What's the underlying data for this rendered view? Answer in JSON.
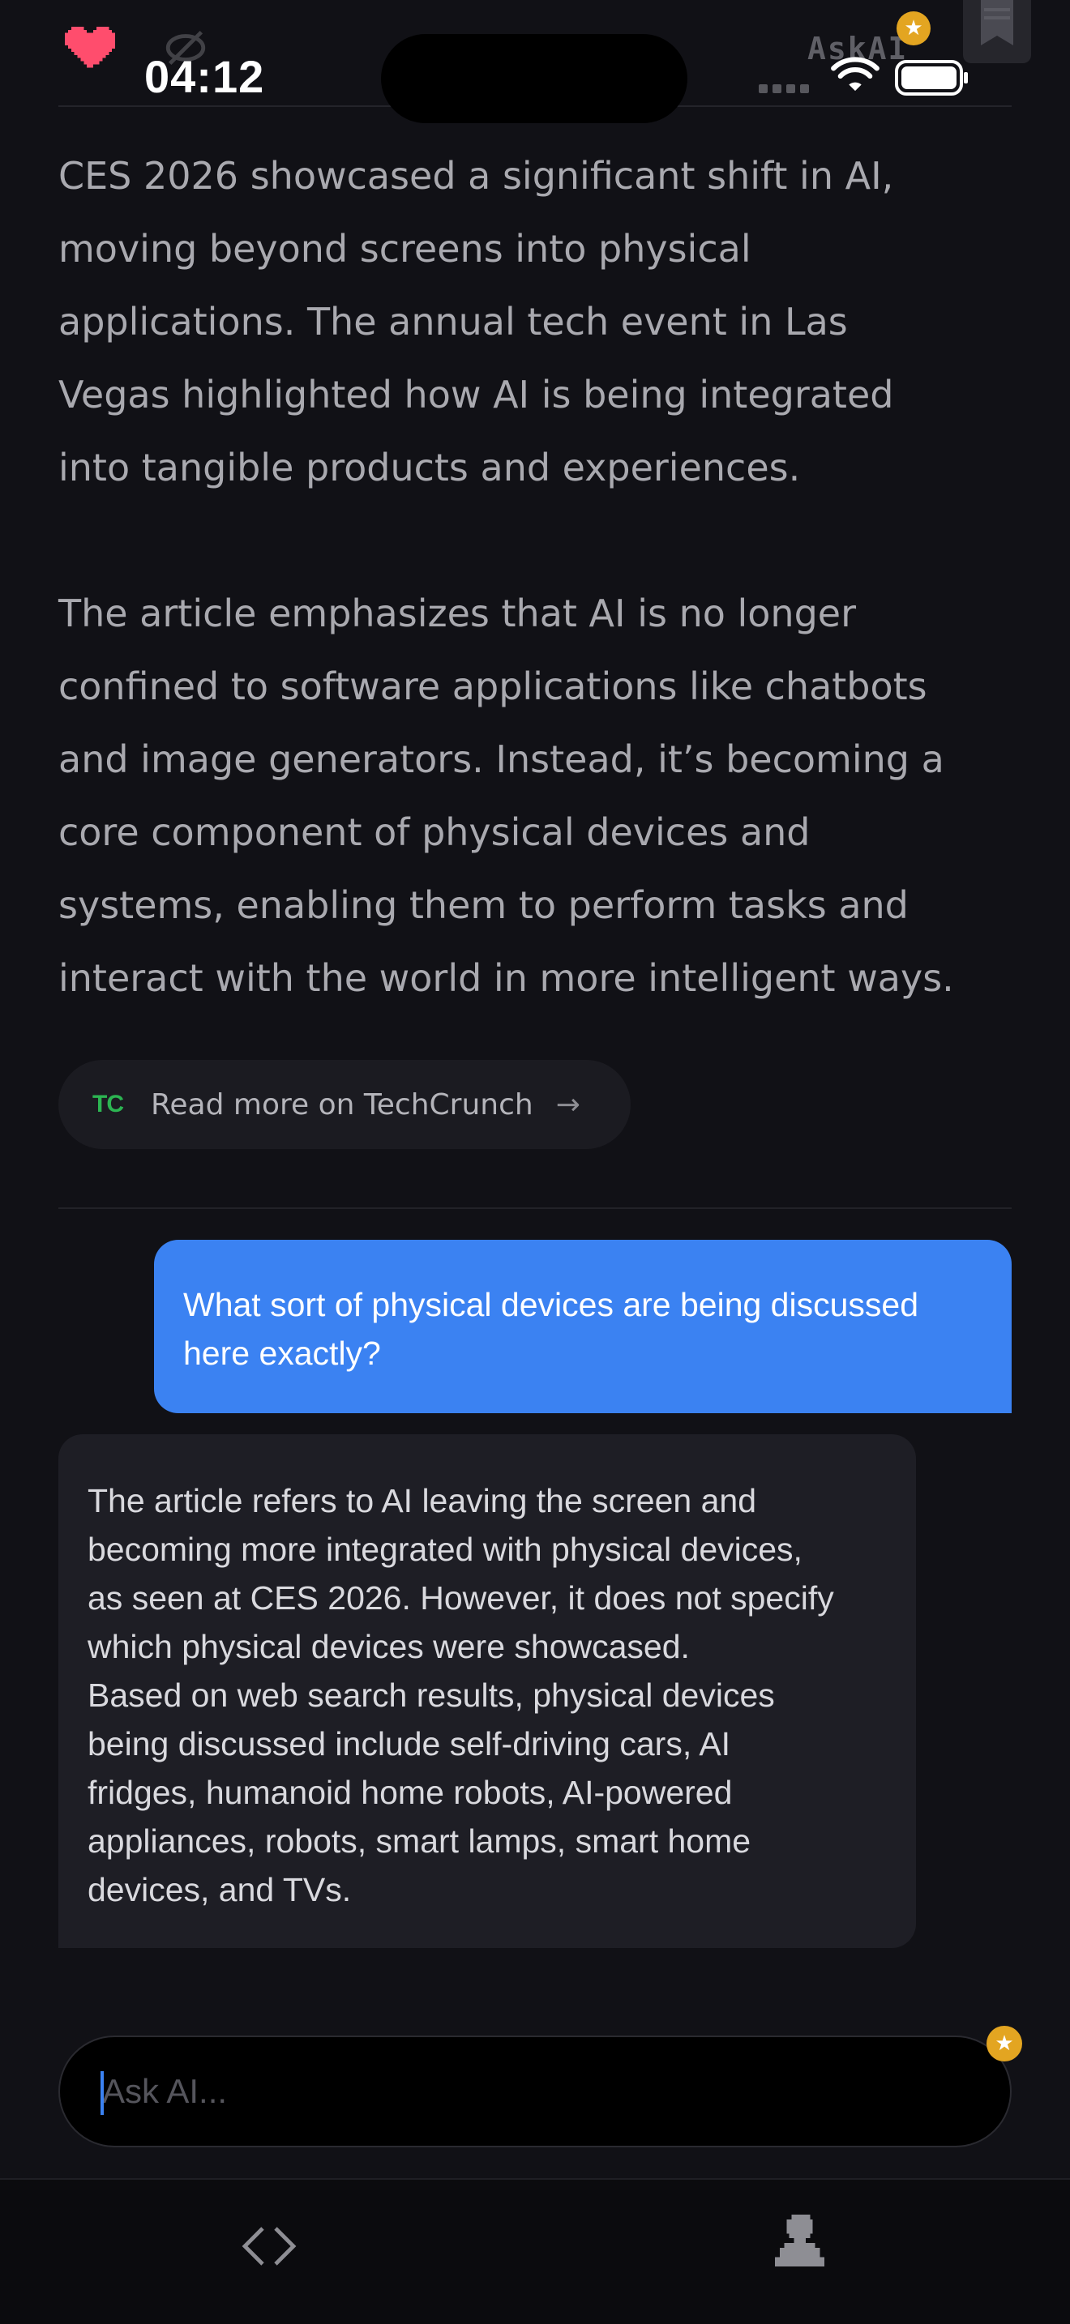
{
  "status_bar": {
    "time": "04:12",
    "app_title": "AskAI",
    "icons": [
      "heart-icon",
      "wifi-icon",
      "battery-icon",
      "bookmark-icon"
    ]
  },
  "article": {
    "paragraphs": [
      "CES 2026 showcased a significant shift in AI,\nmoving beyond screens into physical\napplications. The annual tech event in Las\nVegas highlighted how AI is being integrated\ninto tangible products and experiences.",
      "The article emphasizes that AI is no longer\nconfined to software applications like chatbots\nand image generators. Instead, it’s becoming a\ncore component of physical devices and\nsystems, enabling them to perform tasks and\ninteract with the world in more intelligent ways."
    ],
    "source_logo": "TC",
    "source_link": "Read more on TechCrunch",
    "source_arrow": "→"
  },
  "chat": {
    "user_message": "What sort of physical devices are being discussed\nhere exactly?",
    "ai_reply": [
      "The article refers to AI leaving the screen and\nbecoming more integrated with physical devices,\nas seen at CES 2026. However, it does not specify\nwhich physical devices were showcased.",
      "Based on web search results, physical devices\nbeing discussed include self-driving cars, AI\nfridges, humanoid home robots, AI-powered\nappliances, robots, smart lamps, smart home\ndevices, and TVs."
    ]
  },
  "input": {
    "placeholder": "Ask AI...",
    "value": ""
  },
  "badges": {
    "premium_symbol": "★"
  },
  "colors": {
    "background": "#111116",
    "user_bubble": "#3b82f2",
    "ai_bubble": "#1e1e25",
    "heart": "#ff4d6d",
    "badge": "#e3a521",
    "techcrunch_green": "#2cb552"
  },
  "nav": {
    "items": [
      "code-icon",
      "profile-icon"
    ]
  }
}
